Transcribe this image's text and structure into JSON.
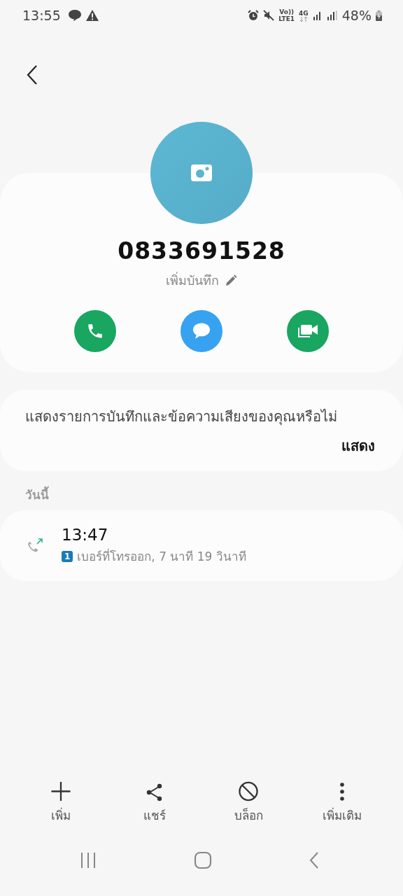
{
  "status_bar": {
    "time": "13:55",
    "volte": "Vo))",
    "lte": "LTE1",
    "network": "4G",
    "battery": "48%"
  },
  "contact": {
    "number": "0833691528",
    "note_label": "เพิ่มบันทึก"
  },
  "actions": [
    {
      "kind": "call",
      "color": "#18a660"
    },
    {
      "kind": "message",
      "color": "#37a2f0"
    },
    {
      "kind": "video",
      "color": "#18a660"
    }
  ],
  "prompt": {
    "text": "แสดงรายการบันทึกและข้อความเสียงของคุณหรือไม่",
    "button": "แสดง"
  },
  "section": "วันนี้",
  "calls": [
    {
      "time": "13:47",
      "sim": "1",
      "detail": "เบอร์ที่โทรออก, 7 นาที 19 วินาที"
    }
  ],
  "toolbar": [
    {
      "kind": "add",
      "label": "เพิ่ม"
    },
    {
      "kind": "share",
      "label": "แชร์"
    },
    {
      "kind": "block",
      "label": "บล็อก"
    },
    {
      "kind": "more",
      "label": "เพิ่มเติม"
    }
  ]
}
